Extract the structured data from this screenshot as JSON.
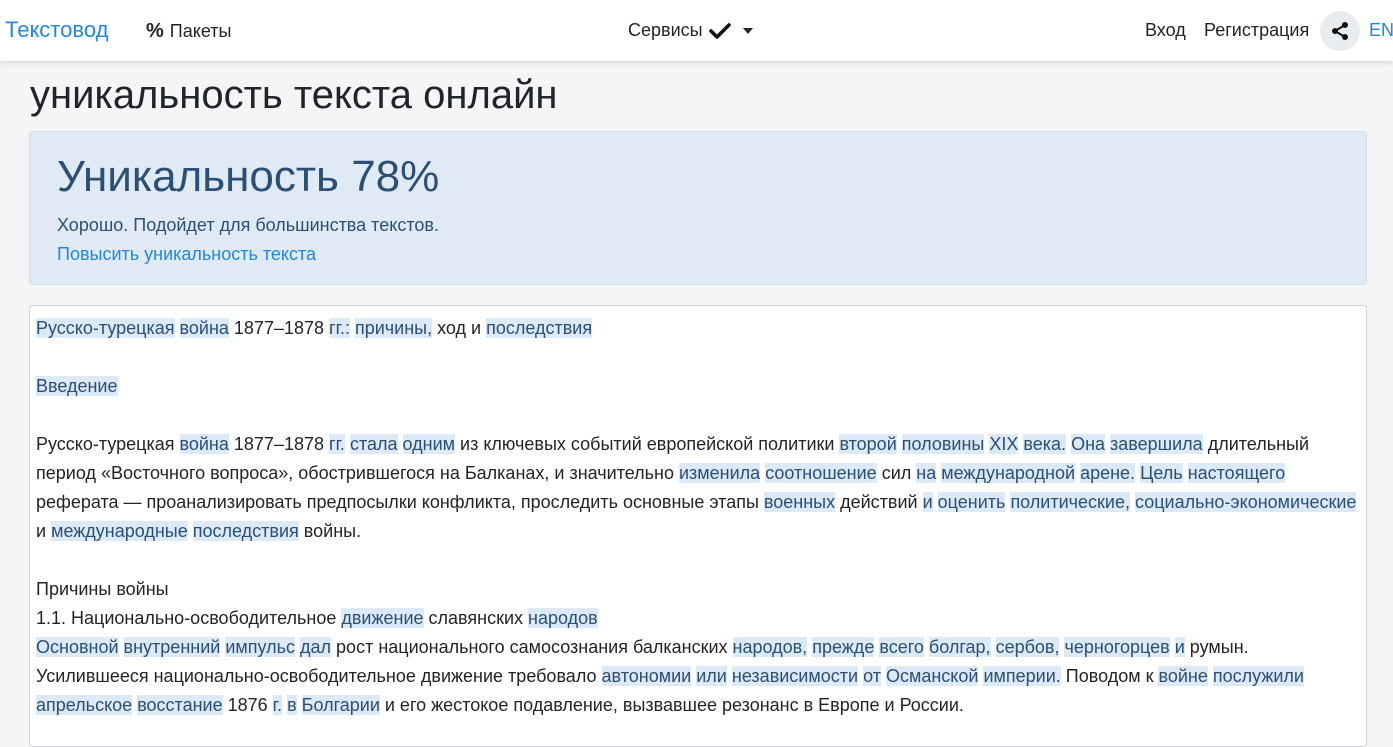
{
  "navbar": {
    "brand": "Текстовод",
    "packages_label": "Пакеты",
    "packages_icon": "percent-icon",
    "services_label": "Сервисы",
    "login_label": "Вход",
    "register_label": "Регистрация",
    "share_icon": "share-icon",
    "language_label": "EN"
  },
  "page": {
    "title": "уникальность текста онлайн"
  },
  "result": {
    "heading": "Уникальность 78%",
    "uniqueness_percent": 78,
    "description": "Хорошо. Подойдет для большинства текстов.",
    "improve_link": "Повысить уникальность текста"
  },
  "colors": {
    "accent": "#1e88e5",
    "highlight_bg": "#dce9f6",
    "result_bg": "#dfeaf5",
    "result_text": "#2c4f74"
  },
  "text": {
    "paragraphs": [
      [
        {
          "t": "Русско-турецкая",
          "h": true
        },
        {
          "t": " "
        },
        {
          "t": "война",
          "h": true
        },
        {
          "t": " 1877–1878 "
        },
        {
          "t": "гг.:",
          "h": true
        },
        {
          "t": " "
        },
        {
          "t": "причины,",
          "h": true
        },
        {
          "t": " ход и "
        },
        {
          "t": "последствия",
          "h": true
        }
      ],
      [],
      [
        {
          "t": "Введение",
          "h": true
        }
      ],
      [],
      [
        {
          "t": "Русско-турецкая "
        },
        {
          "t": "война",
          "h": true
        },
        {
          "t": " 1877–1878 "
        },
        {
          "t": "гг.",
          "h": true
        },
        {
          "t": " "
        },
        {
          "t": "стала",
          "h": true
        },
        {
          "t": " "
        },
        {
          "t": "одним",
          "h": true
        },
        {
          "t": " из ключевых событий европейской политики "
        },
        {
          "t": "второй",
          "h": true
        },
        {
          "t": " "
        },
        {
          "t": "половины",
          "h": true
        },
        {
          "t": " "
        },
        {
          "t": "XIX",
          "h": true
        },
        {
          "t": " "
        },
        {
          "t": "века.",
          "h": true
        },
        {
          "t": " "
        },
        {
          "t": "Она",
          "h": true
        },
        {
          "t": " "
        },
        {
          "t": "завершила",
          "h": true
        },
        {
          "t": " длительный период «Восточного вопроса», обострившегося на Балканах, и значительно "
        },
        {
          "t": "изменила",
          "h": true
        },
        {
          "t": " "
        },
        {
          "t": "соотношение",
          "h": true
        },
        {
          "t": " сил "
        },
        {
          "t": "на",
          "h": true
        },
        {
          "t": " "
        },
        {
          "t": "международной",
          "h": true
        },
        {
          "t": " "
        },
        {
          "t": "арене.",
          "h": true
        },
        {
          "t": " "
        },
        {
          "t": "Цель",
          "h": true
        },
        {
          "t": " "
        },
        {
          "t": "настоящего",
          "h": true
        },
        {
          "t": " реферата — проанализировать предпосылки конфликта, проследить основные этапы "
        },
        {
          "t": "военных",
          "h": true
        },
        {
          "t": " действий "
        },
        {
          "t": "и",
          "h": true
        },
        {
          "t": " "
        },
        {
          "t": "оценить",
          "h": true
        },
        {
          "t": " "
        },
        {
          "t": "политические,",
          "h": true
        },
        {
          "t": " "
        },
        {
          "t": "социально-экономические",
          "h": true
        },
        {
          "t": " и "
        },
        {
          "t": "международные",
          "h": true
        },
        {
          "t": " "
        },
        {
          "t": "последствия",
          "h": true
        },
        {
          "t": " войны."
        }
      ],
      [],
      [
        {
          "t": "Причины войны"
        }
      ],
      [
        {
          "t": "1.1. Национально-освободительное "
        },
        {
          "t": "движение",
          "h": true
        },
        {
          "t": " славянских "
        },
        {
          "t": "народов",
          "h": true
        }
      ],
      [
        {
          "t": "Основной",
          "h": true
        },
        {
          "t": " "
        },
        {
          "t": "внутренний",
          "h": true
        },
        {
          "t": " "
        },
        {
          "t": "импульс",
          "h": true
        },
        {
          "t": " "
        },
        {
          "t": "дал",
          "h": true
        },
        {
          "t": " рост национального самосознания балканских "
        },
        {
          "t": "народов,",
          "h": true
        },
        {
          "t": " "
        },
        {
          "t": "прежде",
          "h": true
        },
        {
          "t": " "
        },
        {
          "t": "всего",
          "h": true
        },
        {
          "t": " "
        },
        {
          "t": "болгар,",
          "h": true
        },
        {
          "t": " "
        },
        {
          "t": "сербов,",
          "h": true
        },
        {
          "t": " "
        },
        {
          "t": "черногорцев",
          "h": true
        },
        {
          "t": " "
        },
        {
          "t": "и",
          "h": true
        },
        {
          "t": " румын. Усилившееся национально-освободительное движение требовало "
        },
        {
          "t": "автономии",
          "h": true
        },
        {
          "t": " "
        },
        {
          "t": "или",
          "h": true
        },
        {
          "t": " "
        },
        {
          "t": "независимости",
          "h": true
        },
        {
          "t": " "
        },
        {
          "t": "от",
          "h": true
        },
        {
          "t": " "
        },
        {
          "t": "Османской",
          "h": true
        },
        {
          "t": " "
        },
        {
          "t": "империи.",
          "h": true
        },
        {
          "t": " Поводом к "
        },
        {
          "t": "войне",
          "h": true
        },
        {
          "t": " "
        },
        {
          "t": "послужили",
          "h": true
        },
        {
          "t": " "
        },
        {
          "t": "апрельское",
          "h": true
        },
        {
          "t": " "
        },
        {
          "t": "восстание",
          "h": true
        },
        {
          "t": " 1876 "
        },
        {
          "t": "г.",
          "h": true
        },
        {
          "t": " "
        },
        {
          "t": "в",
          "h": true
        },
        {
          "t": " "
        },
        {
          "t": "Болгарии",
          "h": true
        },
        {
          "t": " и его жестокое подавление, вызвавшее резонанс в Европе и России."
        }
      ]
    ]
  }
}
